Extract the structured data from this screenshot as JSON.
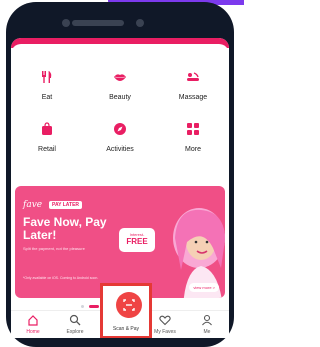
{
  "categories": [
    {
      "label": "Eat",
      "icon": "fork-knife-icon"
    },
    {
      "label": "Beauty",
      "icon": "lips-icon"
    },
    {
      "label": "Massage",
      "icon": "massage-icon"
    },
    {
      "label": "Retail",
      "icon": "shopping-bag-icon"
    },
    {
      "label": "Activities",
      "icon": "compass-icon"
    },
    {
      "label": "More",
      "icon": "grid-icon"
    }
  ],
  "banner": {
    "brand": "fave",
    "tag": "PAY LATER",
    "headline": "Fave Now, Pay Later!",
    "subtext": "Split the payment, not the pleasure",
    "badge_top": "Interest-",
    "badge_main": "FREE",
    "fine_print": "*Only available on iOS. Coming to Android soon.",
    "cta": "view more >"
  },
  "nav": [
    {
      "label": "Home",
      "icon": "home-icon",
      "active": true
    },
    {
      "label": "Explore",
      "icon": "search-icon",
      "active": false
    },
    {
      "label": "Scan & Pay",
      "icon": "scan-icon",
      "active": false
    },
    {
      "label": "My Faves",
      "icon": "heart-icon",
      "active": false
    },
    {
      "label": "Me",
      "icon": "user-icon",
      "active": false
    }
  ],
  "colors": {
    "accent": "#e91e63",
    "banner": "#f04f86",
    "highlight": "#e53935"
  }
}
